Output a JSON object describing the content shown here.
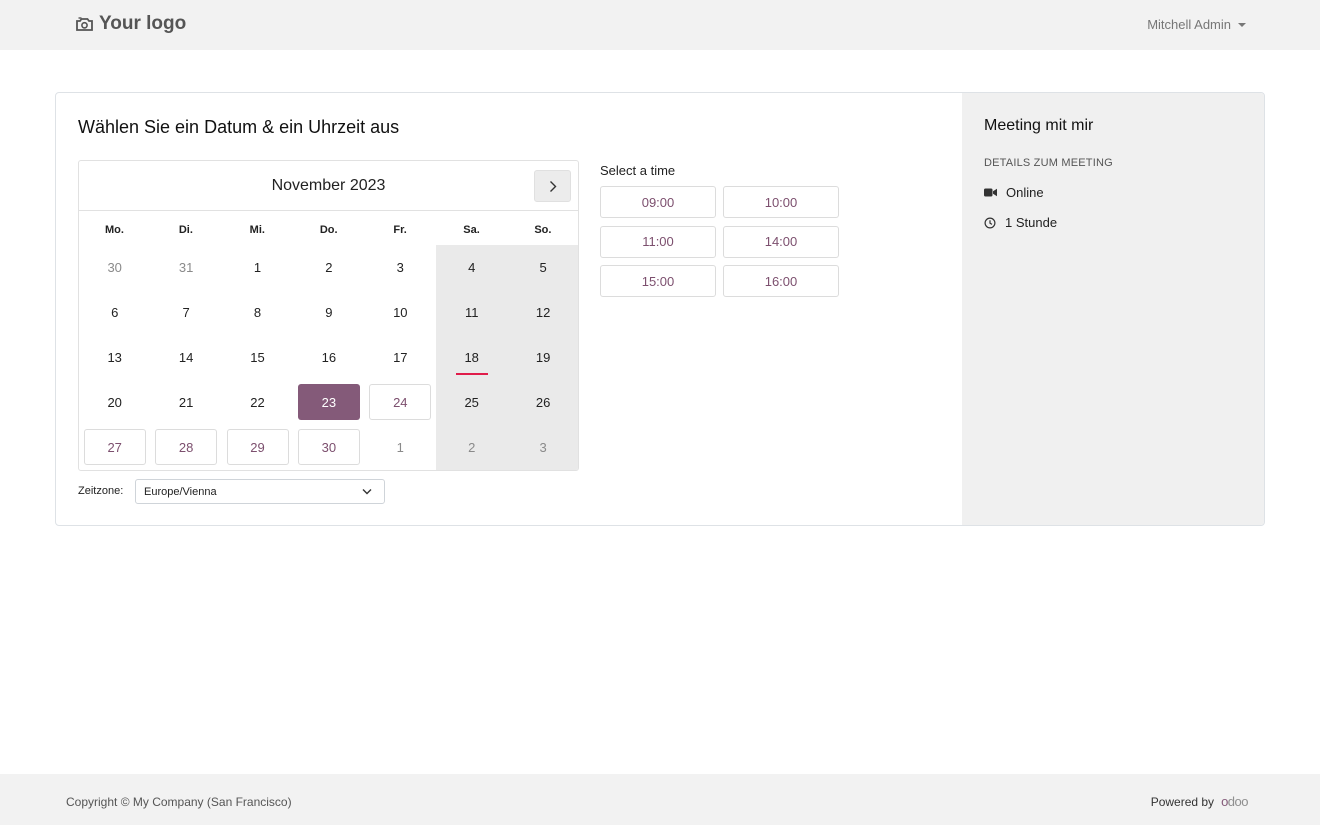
{
  "header": {
    "logo_text": "Your logo",
    "user_name": "Mitchell Admin"
  },
  "main": {
    "heading": "Wählen Sie ein Datum & ein Uhrzeit aus",
    "calendar": {
      "month_label": "November 2023",
      "weekdays": [
        "Mo.",
        "Di.",
        "Mi.",
        "Do.",
        "Fr.",
        "Sa.",
        "So."
      ],
      "weeks": [
        [
          {
            "d": "30",
            "s": "muted"
          },
          {
            "d": "31",
            "s": "muted"
          },
          {
            "d": "1",
            "s": ""
          },
          {
            "d": "2",
            "s": ""
          },
          {
            "d": "3",
            "s": ""
          },
          {
            "d": "4",
            "s": ""
          },
          {
            "d": "5",
            "s": ""
          }
        ],
        [
          {
            "d": "6",
            "s": ""
          },
          {
            "d": "7",
            "s": ""
          },
          {
            "d": "8",
            "s": ""
          },
          {
            "d": "9",
            "s": ""
          },
          {
            "d": "10",
            "s": ""
          },
          {
            "d": "11",
            "s": ""
          },
          {
            "d": "12",
            "s": ""
          }
        ],
        [
          {
            "d": "13",
            "s": ""
          },
          {
            "d": "14",
            "s": ""
          },
          {
            "d": "15",
            "s": ""
          },
          {
            "d": "16",
            "s": ""
          },
          {
            "d": "17",
            "s": ""
          },
          {
            "d": "18",
            "s": "today"
          },
          {
            "d": "19",
            "s": ""
          }
        ],
        [
          {
            "d": "20",
            "s": ""
          },
          {
            "d": "21",
            "s": ""
          },
          {
            "d": "22",
            "s": ""
          },
          {
            "d": "23",
            "s": "selected"
          },
          {
            "d": "24",
            "s": "avail"
          },
          {
            "d": "25",
            "s": ""
          },
          {
            "d": "26",
            "s": ""
          }
        ],
        [
          {
            "d": "27",
            "s": "avail"
          },
          {
            "d": "28",
            "s": "avail"
          },
          {
            "d": "29",
            "s": "avail"
          },
          {
            "d": "30",
            "s": "avail"
          },
          {
            "d": "1",
            "s": "muted"
          },
          {
            "d": "2",
            "s": "muted"
          },
          {
            "d": "3",
            "s": "muted"
          }
        ]
      ]
    },
    "timezone": {
      "label": "Zeitzone:",
      "value": "Europe/Vienna"
    },
    "times": {
      "title": "Select a time",
      "slots": [
        "09:00",
        "10:00",
        "11:00",
        "14:00",
        "15:00",
        "16:00"
      ]
    }
  },
  "sidebar": {
    "title": "Meeting mit mir",
    "subtitle": "DETAILS ZUM MEETING",
    "location": "Online",
    "duration": "1 Stunde"
  },
  "footer": {
    "copyright": "Copyright © My Company (San Francisco)",
    "powered_by": "Powered by",
    "brand": "odoo"
  },
  "colors": {
    "accent": "#845a79",
    "accent_text": "#7c4f6e",
    "today_marker": "#e01c4a"
  }
}
